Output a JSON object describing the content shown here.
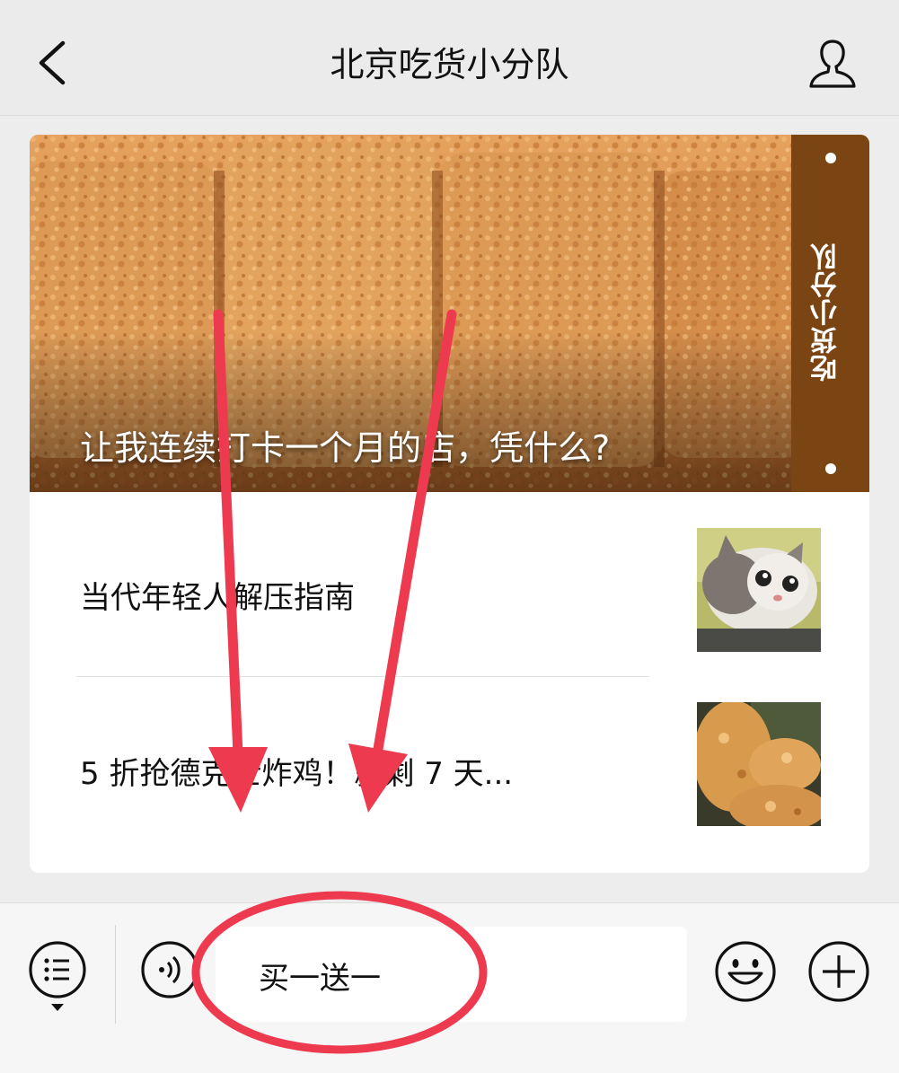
{
  "header": {
    "title": "北京吃货小分队",
    "back_icon": "chevron-left-icon",
    "profile_icon": "person-icon"
  },
  "feed": {
    "hero": {
      "title": "让我连续打卡一个月的店，凭什么?",
      "brand": "吃货小分队"
    },
    "items": [
      {
        "title": "当代年轻人解压指南",
        "thumbnail": "cat-photo"
      },
      {
        "title": "5 折抢德克士炸鸡！就剩 7 天...",
        "thumbnail": "fried-chicken-photo"
      }
    ]
  },
  "input_bar": {
    "menu_icon": "menu-list-icon",
    "voice_icon": "voice-icon",
    "input_value": "买一送一",
    "emoji_icon": "emoji-icon",
    "add_icon": "plus-icon"
  },
  "annotations": {
    "arrow_color": "#ee3a4f",
    "circle_color": "#ee3a4f"
  }
}
